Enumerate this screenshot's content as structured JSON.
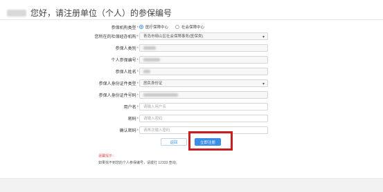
{
  "header": {
    "greeting_suffix": "您好，请注册单位（个人）的参保编号"
  },
  "form": {
    "insurance_type": {
      "label": "参保机构类型",
      "options": [
        "医疗保障中心",
        "社会保障中心"
      ],
      "selected": "医疗保障中心"
    },
    "agency": {
      "label": "您所在的社保经办机构",
      "value": "青岛市崂山区社会保障事务(医保类)"
    },
    "insured_type": {
      "label": "参保人类别"
    },
    "personal_id": {
      "label": "个人参保编号"
    },
    "name": {
      "label": "参保人姓名"
    },
    "id_doc_type": {
      "label": "参保人身份证件类型",
      "value": "居民身份证"
    },
    "id_doc_number": {
      "label": "参保人身份证件号码"
    },
    "username": {
      "label": "用户名",
      "placeholder": "请输入用户名"
    },
    "password": {
      "label": "密码",
      "placeholder": "请输入密码"
    },
    "confirm_password": {
      "label": "确认密码",
      "placeholder": "请再次输入密码"
    },
    "required_mark": "*"
  },
  "buttons": {
    "back": "返回",
    "submit": "立即注册"
  },
  "tips": {
    "title": "温馨提示：",
    "line": "如果找不到您的个人参保编号，请拨打 12333 查询。"
  },
  "colors": {
    "primary": "#3b8ee6",
    "highlight_box": "#c71f1f",
    "required": "#e05050"
  }
}
